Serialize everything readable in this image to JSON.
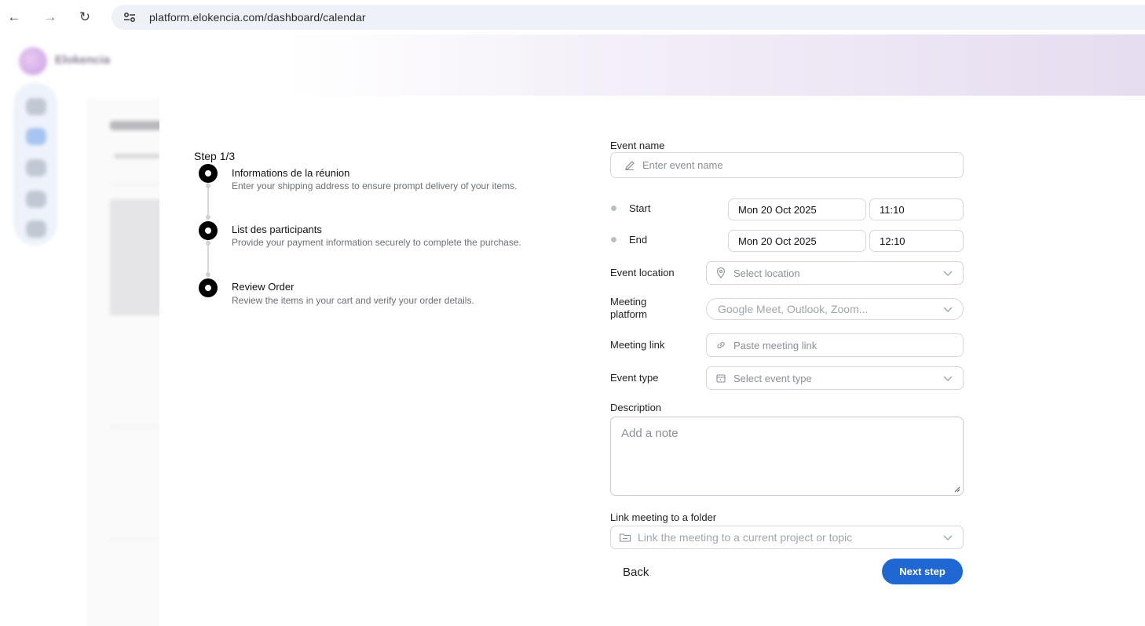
{
  "browser": {
    "url": "platform.elokencia.com/dashboard/calendar",
    "back_icon": "←",
    "forward_icon": "→",
    "reload_icon": "↻"
  },
  "background_app": {
    "brand": "Elokencia"
  },
  "stepper": {
    "step_label": "Step 1/3",
    "steps": [
      {
        "title": "Informations de la réunion",
        "description": "Enter your shipping address to ensure prompt delivery of your items."
      },
      {
        "title": "List des participants",
        "description": "Provide your payment information securely to complete the purchase."
      },
      {
        "title": "Review Order",
        "description": "Review the items in your cart and verify your order details."
      }
    ]
  },
  "form": {
    "event_name": {
      "label": "Event name",
      "placeholder": "Enter event name"
    },
    "start": {
      "label": "Start",
      "date": "Mon 20 Oct 2025",
      "time": "11:10"
    },
    "end": {
      "label": "End",
      "date": "Mon 20 Oct 2025",
      "time": "12:10"
    },
    "event_location": {
      "label": "Event location",
      "placeholder": "Select location"
    },
    "meeting_platform": {
      "label_line1": "Meeting",
      "label_line2": "platform",
      "placeholder": "Google Meet, Outlook, Zoom..."
    },
    "meeting_link": {
      "label": "Meeting link",
      "placeholder": "Paste meeting link"
    },
    "event_type": {
      "label": "Event type",
      "placeholder": "Select event type"
    },
    "description": {
      "label": "Description",
      "placeholder": "Add a note"
    },
    "folder": {
      "label": "Link meeting to a folder",
      "placeholder": "Link the meeting to a current project or topic"
    }
  },
  "actions": {
    "back_label": "Back",
    "next_label": "Next step"
  },
  "colors": {
    "primary": "#1f67d2",
    "step_active": "#000000"
  }
}
